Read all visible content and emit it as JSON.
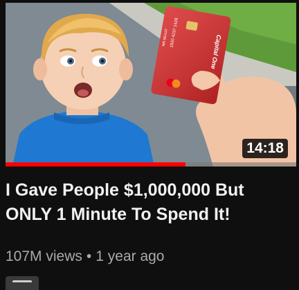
{
  "video": {
    "title": "I Gave People $1,000,000 But ONLY 1 Minute To Spend It!",
    "duration": "14:18",
    "views": "107M views",
    "separator": "•",
    "age": "1 year ago",
    "watch_progress": 0.62,
    "card": {
      "brand": "Capital One",
      "number_line": "1920 4237 1428",
      "name": "MR BEAST"
    }
  },
  "colors": {
    "background": "#0f0f0f",
    "progress": "#ff0000",
    "title": "#f1f1f1",
    "meta": "#aaaaaa"
  }
}
